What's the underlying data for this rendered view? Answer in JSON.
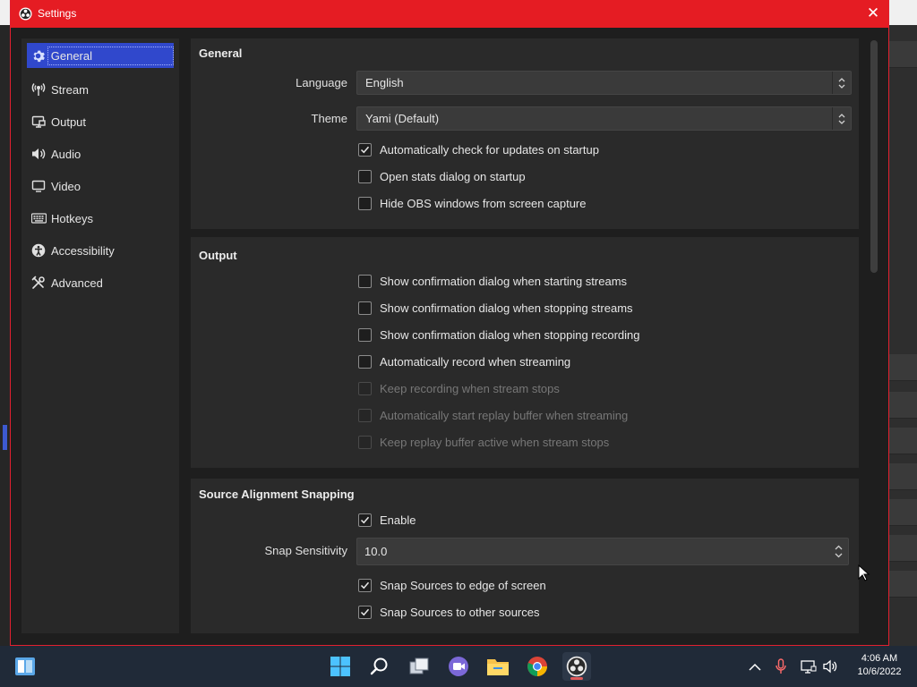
{
  "window": {
    "title": "Settings",
    "close_glyph": "✕"
  },
  "sidebar": {
    "items": [
      {
        "label": "General",
        "icon": "gear-icon",
        "active": true
      },
      {
        "label": "Stream",
        "icon": "antenna-icon"
      },
      {
        "label": "Output",
        "icon": "output-icon"
      },
      {
        "label": "Audio",
        "icon": "speaker-icon"
      },
      {
        "label": "Video",
        "icon": "monitor-icon"
      },
      {
        "label": "Hotkeys",
        "icon": "keyboard-icon"
      },
      {
        "label": "Accessibility",
        "icon": "accessibility-icon"
      },
      {
        "label": "Advanced",
        "icon": "tools-icon"
      }
    ]
  },
  "general": {
    "title": "General",
    "language_label": "Language",
    "language_value": "English",
    "theme_label": "Theme",
    "theme_value": "Yami (Default)",
    "checks": [
      {
        "label": "Automatically check for updates on startup",
        "checked": true
      },
      {
        "label": "Open stats dialog on startup",
        "checked": false
      },
      {
        "label": "Hide OBS windows from screen capture",
        "checked": false
      }
    ]
  },
  "output": {
    "title": "Output",
    "checks": [
      {
        "label": "Show confirmation dialog when starting streams",
        "checked": false,
        "disabled": false
      },
      {
        "label": "Show confirmation dialog when stopping streams",
        "checked": false,
        "disabled": false
      },
      {
        "label": "Show confirmation dialog when stopping recording",
        "checked": false,
        "disabled": false
      },
      {
        "label": "Automatically record when streaming",
        "checked": false,
        "disabled": false
      },
      {
        "label": "Keep recording when stream stops",
        "checked": false,
        "disabled": true
      },
      {
        "label": "Automatically start replay buffer when streaming",
        "checked": false,
        "disabled": true
      },
      {
        "label": "Keep replay buffer active when stream stops",
        "checked": false,
        "disabled": true
      }
    ]
  },
  "snapping": {
    "title": "Source Alignment Snapping",
    "enable_label": "Enable",
    "enable_checked": true,
    "sensitivity_label": "Snap Sensitivity",
    "sensitivity_value": "10.0",
    "checks": [
      {
        "label": "Snap Sources to edge of screen",
        "checked": true
      },
      {
        "label": "Snap Sources to other sources",
        "checked": true
      }
    ]
  },
  "taskbar": {
    "time": "4:06 AM",
    "date": "10/6/2022"
  },
  "colors": {
    "titlebar": "#e51c23",
    "accent": "#3048cc",
    "taskbar": "#202a38"
  }
}
